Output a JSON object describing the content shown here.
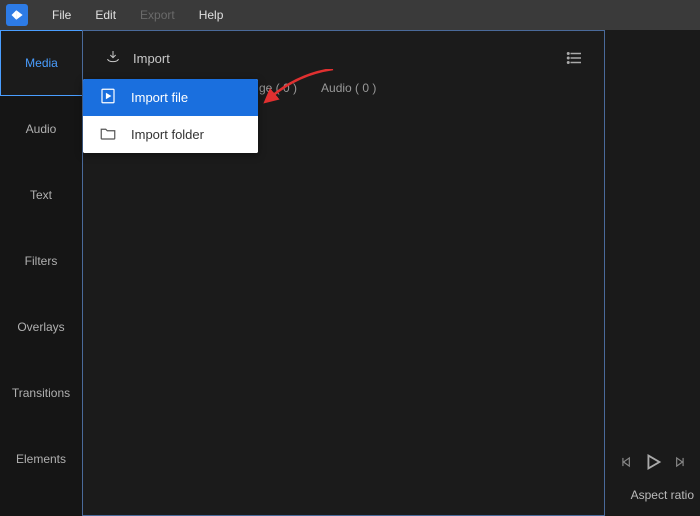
{
  "menu": {
    "file": "File",
    "edit": "Edit",
    "export": "Export",
    "help": "Help"
  },
  "sidebar": {
    "items": [
      "Media",
      "Audio",
      "Text",
      "Filters",
      "Overlays",
      "Transitions",
      "Elements"
    ]
  },
  "toolbar": {
    "import_label": "Import"
  },
  "categories": {
    "image": "ge ( 0 )",
    "audio": "Audio ( 0 )"
  },
  "dropdown": {
    "import_file": "Import file",
    "import_folder": "Import folder"
  },
  "footer": {
    "aspect_ratio": "Aspect ratio"
  }
}
